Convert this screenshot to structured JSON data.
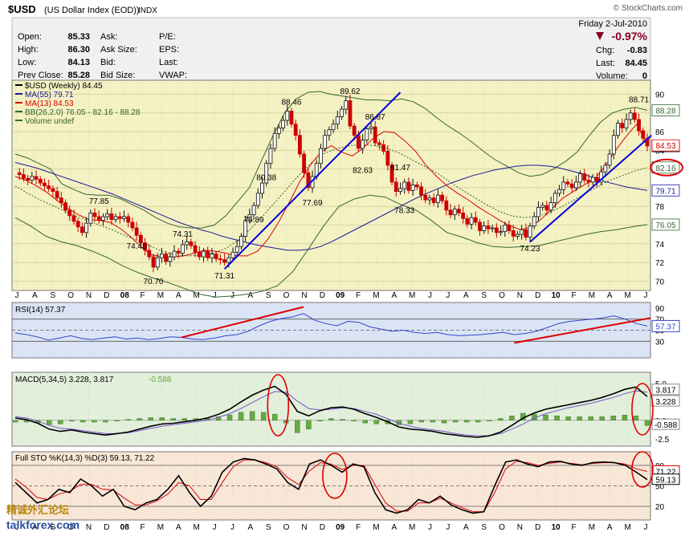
{
  "header": {
    "symbol": "$USD",
    "name": "(US Dollar Index (EOD))",
    "exchange": "INDX",
    "watermark": "© StockCharts.com",
    "date": "Friday  2-Jul-2010",
    "pct_change": "-0.97%",
    "quote_left": [
      {
        "label": "Open:",
        "value": "85.33"
      },
      {
        "label": "High:",
        "value": "86.30"
      },
      {
        "label": "Low:",
        "value": "84.13"
      },
      {
        "label": "Prev Close:",
        "value": "85.28"
      }
    ],
    "quote_mid": [
      "Ask:",
      "Ask Size:",
      "Bid:",
      "Bid Size:"
    ],
    "quote_mid2": [
      "P/E:",
      "EPS:",
      "Last:",
      "VWAP:"
    ],
    "quote_right": [
      {
        "label": "Chg:",
        "value": "-0.83"
      },
      {
        "label": "Last:",
        "value": "84.45"
      },
      {
        "label": "Volume:",
        "value": "0"
      }
    ]
  },
  "colors": {
    "price_bg": "#f4f1c2",
    "rsi_bg": "#dbe4f5",
    "macd_bg": "#e2efda",
    "sto_bg": "#f8e6d6",
    "up": "#111111",
    "down": "#cc0000",
    "ma55": "#1a1a99",
    "ma13": "#dd0000",
    "bb": "#336633",
    "trend_blue": "#0000dd",
    "trend_red": "#dd0000"
  },
  "chart_data": [
    {
      "type": "line",
      "panel": "price",
      "legend": [
        "$USD (Weekly) 84.45",
        "MA(55) 79.71",
        "MA(13) 84.53",
        "BB(26,2.0) 76.05 - 82.16 - 88.28",
        "Volume undef"
      ],
      "ylim": [
        69,
        91.5
      ],
      "y_ticks": [
        "90",
        "88",
        "86",
        "84",
        "82",
        "80",
        "78",
        "76",
        "74",
        "72",
        "70"
      ],
      "x_ticks": [
        "J",
        "A",
        "S",
        "O",
        "N",
        "D",
        "08",
        "F",
        "M",
        "A",
        "M",
        "J",
        "J",
        "A",
        "S",
        "O",
        "N",
        "D",
        "09",
        "F",
        "M",
        "A",
        "M",
        "J",
        "J",
        "A",
        "S",
        "O",
        "N",
        "D",
        "10",
        "F",
        "M",
        "A",
        "M",
        "J"
      ],
      "right_labels": [
        "88.28",
        "84.45",
        "84.53",
        "82.16",
        "79.71",
        "76.05"
      ],
      "annotations": [
        "77.85",
        "74.48",
        "74.31",
        "70.70",
        "71.31",
        "75.89",
        "80.38",
        "88.46",
        "77.69",
        "89.62",
        "86.87",
        "82.63",
        "81.47",
        "78.33",
        "74.23",
        "88.71"
      ],
      "close_weekly": [
        81.6,
        81.4,
        81.0,
        80.8,
        81.2,
        80.9,
        80.5,
        80.2,
        79.9,
        79.6,
        78.9,
        78.4,
        77.6,
        77.0,
        76.4,
        75.8,
        75.2,
        76.2,
        77.3,
        76.9,
        76.5,
        76.9,
        77.2,
        76.6,
        76.9,
        76.7,
        76.9,
        76.3,
        75.7,
        74.9,
        74.1,
        73.3,
        72.6,
        71.5,
        72.5,
        72.9,
        72.1,
        72.6,
        73.2,
        73.0,
        73.9,
        74.2,
        73.8,
        73.1,
        72.6,
        73.2,
        72.5,
        72.9,
        72.4,
        72.3,
        72.0,
        72.5,
        73.1,
        73.7,
        74.8,
        76.5,
        77.1,
        78.1,
        79.4,
        80.5,
        82.6,
        84.2,
        85.8,
        86.4,
        87.2,
        88.2,
        86.8,
        85.6,
        83.6,
        81.6,
        80.0,
        81.2,
        82.6,
        84.2,
        85.6,
        86.2,
        86.8,
        87.6,
        88.4,
        89.3,
        86.6,
        85.6,
        84.2,
        85.1,
        86.3,
        86.5,
        84.8,
        84.6,
        83.9,
        82.4,
        80.6,
        79.6,
        79.9,
        80.6,
        79.7,
        80.3,
        80.1,
        79.2,
        78.7,
        78.9,
        78.4,
        79.2,
        78.6,
        77.6,
        77.1,
        77.7,
        77.3,
        76.7,
        76.1,
        76.8,
        76.3,
        75.4,
        75.9,
        75.6,
        75.7,
        75.2,
        75.3,
        76.0,
        75.4,
        74.8,
        75.0,
        75.5,
        74.7,
        75.9,
        76.9,
        77.9,
        78.1,
        77.6,
        78.4,
        79.4,
        79.8,
        80.6,
        80.4,
        80.0,
        80.6,
        81.5,
        80.8,
        80.6,
        81.1,
        80.6,
        81.7,
        82.4,
        83.6,
        85.6,
        86.9,
        86.4,
        87.3,
        88.0,
        87.3,
        86.1,
        85.3,
        84.45
      ],
      "ma55": [
        82.7,
        82.4,
        82.1,
        81.7,
        81.3,
        80.9,
        80.5,
        80.1,
        79.7,
        79.3,
        78.8,
        78.3,
        77.8,
        77.3,
        76.8,
        76.3,
        75.9,
        75.5,
        75.2,
        74.8,
        74.5,
        74.2,
        73.9,
        73.7,
        73.5,
        73.3,
        73.3,
        73.4,
        73.7,
        74.2,
        74.8,
        75.4,
        76.0,
        76.6,
        77.2,
        77.8,
        78.4,
        79.0,
        79.5,
        80.0,
        80.5,
        80.9,
        81.3,
        81.6,
        81.9,
        82.1,
        82.3,
        82.4,
        82.4,
        82.3,
        82.1,
        81.8,
        81.5,
        81.1,
        80.7,
        80.4,
        80.1,
        79.9,
        79.71
      ],
      "ma13": [
        81.2,
        80.8,
        80.2,
        79.5,
        78.6,
        77.8,
        77.1,
        76.6,
        76.5,
        76.3,
        75.6,
        74.7,
        73.6,
        72.8,
        72.6,
        72.6,
        72.7,
        73.0,
        73.3,
        73.2,
        73.0,
        72.7,
        72.7,
        73.2,
        74.5,
        76.3,
        78.4,
        80.6,
        82.4,
        83.8,
        84.5,
        83.8,
        83.4,
        84.2,
        85.3,
        86.0,
        85.9,
        85.0,
        83.9,
        82.4,
        81.2,
        80.2,
        79.4,
        78.7,
        77.9,
        77.2,
        76.5,
        75.9,
        75.5,
        75.8,
        76.7,
        77.8,
        78.9,
        79.6,
        80.3,
        80.9,
        82.3,
        84.0,
        85.5,
        86.8,
        84.53
      ],
      "bb_upper": [
        83.6,
        83.2,
        82.6,
        82.0,
        80.4,
        79.8,
        79.3,
        79.2,
        79.2,
        78.8,
        78.2,
        77.6,
        76.8,
        76.2,
        75.8,
        75.7,
        75.7,
        76.0,
        77.0,
        78.5,
        80.0,
        82.8,
        85.5,
        88.0,
        89.5,
        90.2,
        90.3,
        90.0,
        89.8,
        89.6,
        89.4,
        89.4,
        89.3,
        89.5,
        89.2,
        88.5,
        87.5,
        86.6,
        85.8,
        84.9,
        83.9,
        83.0,
        82.3,
        81.6,
        81.2,
        81.4,
        82.0,
        82.8,
        83.8,
        85.5,
        87.0,
        88.0,
        88.4,
        88.6,
        88.28
      ],
      "bb_mid": [
        80.2,
        79.4,
        78.7,
        78.1,
        77.5,
        76.9,
        76.4,
        75.9,
        75.4,
        74.8,
        74.3,
        73.7,
        73.1,
        72.8,
        72.7,
        72.8,
        73.0,
        73.5,
        74.4,
        75.6,
        77.0,
        78.5,
        80.0,
        81.5,
        82.8,
        83.7,
        84.2,
        84.5,
        84.6,
        84.5,
        84.2,
        83.7,
        83.0,
        82.3,
        81.6,
        80.7,
        79.8,
        79.0,
        78.2,
        77.5,
        77.0,
        76.8,
        76.9,
        77.3,
        77.9,
        78.6,
        79.4,
        80.1,
        80.8,
        81.3,
        81.8,
        82.16
      ],
      "bb_lower": [
        76.8,
        75.9,
        74.8,
        74.2,
        73.8,
        73.2,
        72.5,
        71.6,
        70.9,
        70.3,
        69.8,
        69.2,
        68.6,
        68.3,
        68.4,
        68.6,
        68.9,
        69.5,
        71.0,
        73.4,
        75.9,
        78.0,
        78.8,
        79.2,
        79.0,
        78.2,
        77.6,
        76.5,
        75.2,
        74.7,
        74.1,
        73.7,
        73.6,
        73.7,
        73.8,
        74.2,
        74.6,
        75.0,
        75.3,
        75.5,
        75.8,
        76.05
      ]
    },
    {
      "type": "line",
      "panel": "rsi",
      "legend": "RSI(14) 57.37",
      "ylim": [
        0,
        100
      ],
      "y_ticks": [
        "90",
        "70",
        "50",
        "30"
      ],
      "right_label": "57.37",
      "values": [
        45,
        42,
        38,
        32,
        36,
        40,
        35,
        33,
        36,
        38,
        34,
        36,
        33,
        35,
        38,
        37,
        34,
        33,
        36,
        40,
        42,
        48,
        58,
        66,
        71,
        74,
        80,
        68,
        62,
        58,
        66,
        64,
        56,
        52,
        48,
        50,
        46,
        44,
        46,
        42,
        40,
        41,
        42,
        44,
        46,
        42,
        44,
        48,
        55,
        62,
        66,
        68,
        70,
        72,
        76,
        70,
        62,
        57.37
      ]
    },
    {
      "type": "line",
      "panel": "macd",
      "legend": [
        "MACD(5,34,5) 3.228, 3.817",
        "-0.588"
      ],
      "ylim": [
        -3.5,
        6.5
      ],
      "y_ticks": [
        "5.0",
        "2.5",
        "0.0",
        "-2.5"
      ],
      "right_labels": [
        "3.817",
        "3.228",
        "-0.588"
      ],
      "macd": [
        0.3,
        0.1,
        -0.4,
        -1.2,
        -1.5,
        -1.3,
        -1.6,
        -1.8,
        -2.0,
        -1.8,
        -1.6,
        -1.2,
        -0.8,
        -0.5,
        -0.4,
        -0.2,
        0.0,
        0.3,
        0.8,
        1.5,
        2.5,
        3.4,
        4.1,
        4.6,
        3.5,
        1.2,
        0.6,
        1.3,
        1.7,
        1.8,
        1.5,
        0.9,
        0.4,
        -0.2,
        -0.9,
        -1.2,
        -1.3,
        -1.5,
        -1.8,
        -2.0,
        -2.2,
        -2.3,
        -2.1,
        -1.6,
        -0.7,
        0.3,
        1.0,
        1.5,
        1.8,
        2.1,
        2.4,
        2.7,
        3.1,
        3.6,
        4.2,
        4.5,
        3.228
      ],
      "signal": [
        0.5,
        0.3,
        -0.1,
        -0.7,
        -1.1,
        -1.2,
        -1.4,
        -1.6,
        -1.8,
        -1.8,
        -1.7,
        -1.4,
        -1.1,
        -0.8,
        -0.6,
        -0.4,
        -0.2,
        0.0,
        0.4,
        0.9,
        1.6,
        2.4,
        3.2,
        3.9,
        3.8,
        2.6,
        1.6,
        1.4,
        1.5,
        1.7,
        1.6,
        1.2,
        0.8,
        0.2,
        -0.4,
        -0.8,
        -1.1,
        -1.3,
        -1.5,
        -1.8,
        -2.0,
        -2.1,
        -2.1,
        -1.8,
        -1.2,
        -0.5,
        0.3,
        0.9,
        1.3,
        1.7,
        2.0,
        2.3,
        2.7,
        3.1,
        3.6,
        4.0,
        3.817
      ]
    },
    {
      "type": "line",
      "panel": "sto",
      "legend": "Full STO %K(14,3) %D(3) 59.13, 71.22",
      "ylim": [
        0,
        100
      ],
      "y_ticks": [
        "80",
        "50",
        "20"
      ],
      "right_labels": [
        "71.22",
        "59.13"
      ],
      "k": [
        55,
        40,
        25,
        30,
        45,
        40,
        60,
        50,
        35,
        45,
        20,
        15,
        25,
        30,
        45,
        65,
        40,
        20,
        35,
        70,
        85,
        90,
        88,
        82,
        75,
        55,
        45,
        82,
        88,
        80,
        70,
        82,
        78,
        40,
        15,
        10,
        15,
        30,
        25,
        35,
        22,
        15,
        10,
        12,
        50,
        85,
        88,
        82,
        78,
        85,
        86,
        82,
        80,
        84,
        85,
        84,
        80,
        70,
        59.13
      ],
      "d": [
        60,
        48,
        33,
        30,
        38,
        42,
        52,
        52,
        45,
        44,
        32,
        22,
        22,
        28,
        38,
        55,
        50,
        30,
        30,
        55,
        78,
        88,
        88,
        84,
        78,
        62,
        52,
        72,
        84,
        82,
        74,
        80,
        80,
        52,
        25,
        13,
        13,
        25,
        25,
        32,
        25,
        18,
        12,
        12,
        40,
        75,
        86,
        84,
        80,
        83,
        85,
        83,
        81,
        83,
        84,
        84,
        82,
        75,
        71.22
      ]
    }
  ],
  "footer": {
    "logo_cn": "精诚外汇论坛",
    "logo_site": "talkforex.com"
  }
}
